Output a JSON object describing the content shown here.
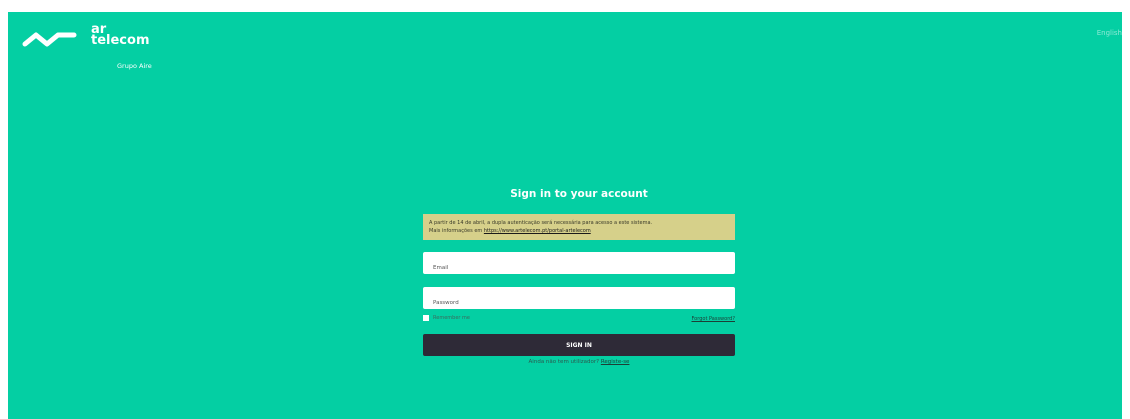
{
  "brand": {
    "logo_line1": "ar",
    "logo_line2": "telecom",
    "subtitle": "Grupo Aire",
    "color": "#04cfa3"
  },
  "header": {
    "language": "English"
  },
  "login": {
    "title": "Sign in to your account",
    "notice_line1": "A partir de 14 de abril, a dupla autenticação será necessária para acesso a este sistema.",
    "notice_line2_prefix": "Mais informações em ",
    "notice_link": "https://www.artelecom.pt/portal-artelecom",
    "email_placeholder": "Email",
    "password_placeholder": "Password",
    "remember_label": "Remember me",
    "forgot_label": "Forgot Password?",
    "signin_label": "SIGN IN",
    "register_prefix": "Ainda não tem utilizador? ",
    "register_link": "Registe-se",
    "button_color": "#2e2a37",
    "notice_color": "#d6d08a"
  }
}
